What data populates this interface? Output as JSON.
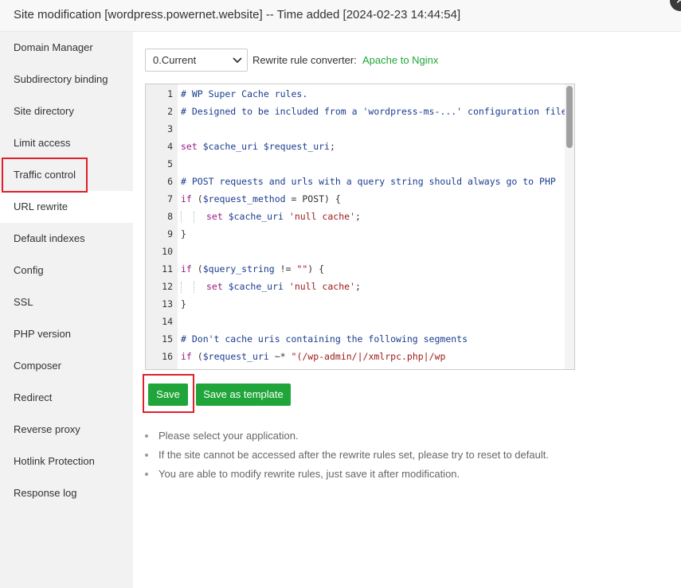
{
  "window": {
    "title": "Site modification [wordpress.powernet.website] -- Time added [2024-02-23 14:44:54]",
    "close_glyph": "✕"
  },
  "sidebar": {
    "items": [
      {
        "label": "Domain Manager"
      },
      {
        "label": "Subdirectory binding"
      },
      {
        "label": "Site directory"
      },
      {
        "label": "Limit access"
      },
      {
        "label": "Traffic control"
      },
      {
        "label": "URL rewrite",
        "active": true
      },
      {
        "label": "Default indexes"
      },
      {
        "label": "Config"
      },
      {
        "label": "SSL"
      },
      {
        "label": "PHP version"
      },
      {
        "label": "Composer"
      },
      {
        "label": "Redirect"
      },
      {
        "label": "Reverse proxy"
      },
      {
        "label": "Hotlink Protection"
      },
      {
        "label": "Response log"
      }
    ]
  },
  "toolbar": {
    "version_select": {
      "value": "0.Current"
    },
    "converter_label": "Rewrite rule converter:",
    "converter_link": "Apache to Nginx"
  },
  "editor": {
    "lines": [
      {
        "num": "1",
        "segments": [
          {
            "t": "# WP Super Cache rules.",
            "c": "comment"
          }
        ]
      },
      {
        "num": "2",
        "segments": [
          {
            "t": "# Designed to be included from a 'wordpress-ms-...' configuration file.",
            "c": "comment"
          }
        ]
      },
      {
        "num": "3",
        "segments": []
      },
      {
        "num": "4",
        "segments": [
          {
            "t": "set ",
            "c": "kw"
          },
          {
            "t": "$cache_uri",
            "c": "var"
          },
          {
            "t": " ",
            "c": "op"
          },
          {
            "t": "$request_uri",
            "c": "var"
          },
          {
            "t": ";",
            "c": "op"
          }
        ]
      },
      {
        "num": "5",
        "segments": []
      },
      {
        "num": "6",
        "segments": [
          {
            "t": "# POST requests and urls with a query string should always go to PHP",
            "c": "comment"
          }
        ]
      },
      {
        "num": "7",
        "segments": [
          {
            "t": "if",
            "c": "kw"
          },
          {
            "t": " (",
            "c": "op"
          },
          {
            "t": "$request_method",
            "c": "var"
          },
          {
            "t": " = POST) {",
            "c": "op"
          }
        ]
      },
      {
        "num": "8",
        "indent": 2,
        "segments": [
          {
            "t": "set ",
            "c": "kw"
          },
          {
            "t": "$cache_uri",
            "c": "var"
          },
          {
            "t": " ",
            "c": "op"
          },
          {
            "t": "'null cache'",
            "c": "str"
          },
          {
            "t": ";",
            "c": "op"
          }
        ]
      },
      {
        "num": "9",
        "segments": [
          {
            "t": "}",
            "c": "op"
          }
        ]
      },
      {
        "num": "10",
        "segments": []
      },
      {
        "num": "11",
        "segments": [
          {
            "t": "if",
            "c": "kw"
          },
          {
            "t": " (",
            "c": "op"
          },
          {
            "t": "$query_string",
            "c": "var"
          },
          {
            "t": " != ",
            "c": "op"
          },
          {
            "t": "\"\"",
            "c": "str"
          },
          {
            "t": ") {",
            "c": "op"
          }
        ]
      },
      {
        "num": "12",
        "indent": 2,
        "segments": [
          {
            "t": "set ",
            "c": "kw"
          },
          {
            "t": "$cache_uri",
            "c": "var"
          },
          {
            "t": " ",
            "c": "op"
          },
          {
            "t": "'null cache'",
            "c": "str"
          },
          {
            "t": ";",
            "c": "op"
          }
        ]
      },
      {
        "num": "13",
        "segments": [
          {
            "t": "}",
            "c": "op"
          }
        ]
      },
      {
        "num": "14",
        "segments": []
      },
      {
        "num": "15",
        "segments": [
          {
            "t": "# Don't cache uris containing the following segments",
            "c": "comment"
          }
        ]
      },
      {
        "num": "16",
        "segments": [
          {
            "t": "if",
            "c": "kw"
          },
          {
            "t": " (",
            "c": "op"
          },
          {
            "t": "$request_uri",
            "c": "var"
          },
          {
            "t": " ~* ",
            "c": "op"
          },
          {
            "t": "\"(/wp-admin/|/xmlrpc.php|/wp",
            "c": "str"
          }
        ]
      }
    ]
  },
  "actions": {
    "save_label": "Save",
    "save_template_label": "Save as template"
  },
  "tips": [
    "Please select your application.",
    "If the site cannot be accessed after the rewrite rules set, please try to reset to default.",
    "You are able to modify rewrite rules, just save it after modification."
  ],
  "colors": {
    "accent": "#20a53a",
    "highlight_outline": "#e0202a"
  }
}
